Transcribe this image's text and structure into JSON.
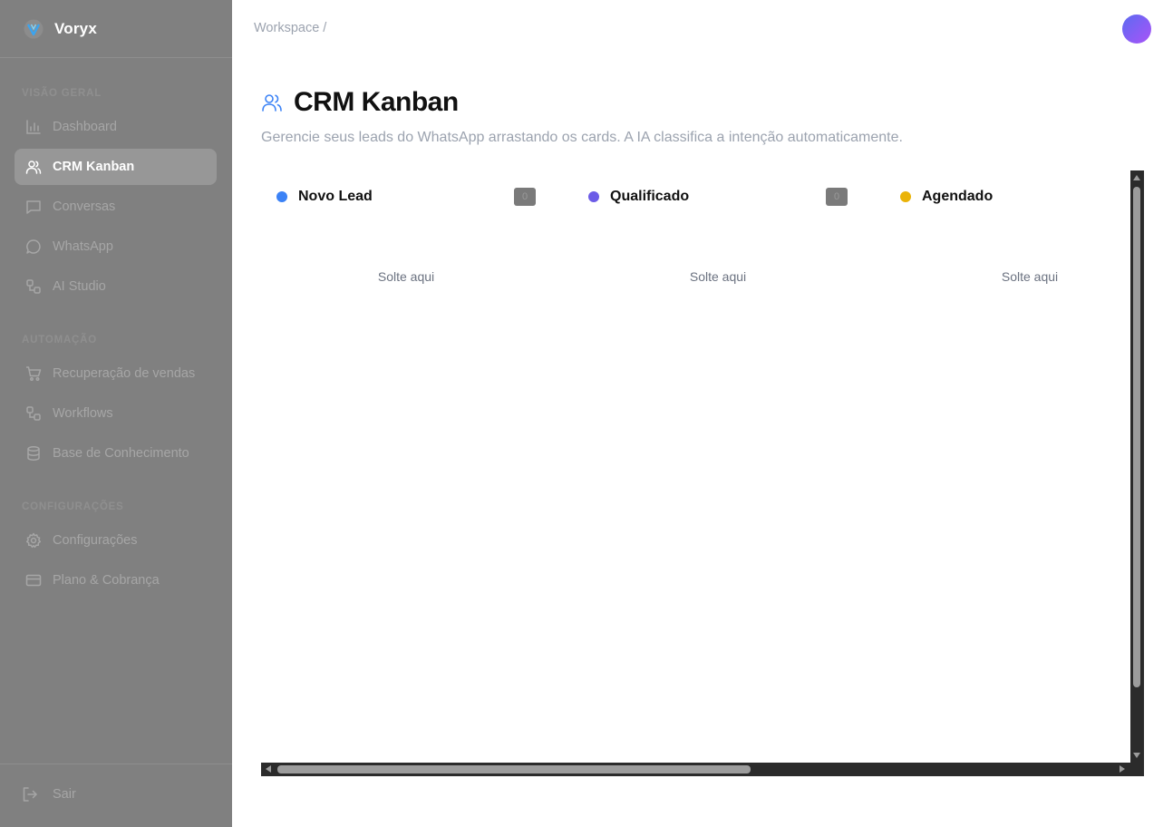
{
  "brand": {
    "name": "Voryx"
  },
  "sidebar": {
    "sections": [
      {
        "label": "VISÃO GERAL"
      },
      {
        "label": "AUTOMAÇÃO"
      },
      {
        "label": "CONFIGURAÇÕES"
      }
    ],
    "items": [
      {
        "label": "Dashboard",
        "icon": "bar-chart-icon",
        "active": false
      },
      {
        "label": "CRM Kanban",
        "icon": "users-icon",
        "active": true
      },
      {
        "label": "Conversas",
        "icon": "message-square-icon",
        "active": false
      },
      {
        "label": "WhatsApp",
        "icon": "message-circle-icon",
        "active": false
      },
      {
        "label": "AI Studio",
        "icon": "nodes-icon",
        "active": false
      },
      {
        "label": "Recuperação de vendas",
        "icon": "cart-icon",
        "active": false
      },
      {
        "label": "Workflows",
        "icon": "workflow-icon",
        "active": false
      },
      {
        "label": "Base de Conhecimento",
        "icon": "database-icon",
        "active": false
      },
      {
        "label": "Configurações",
        "icon": "gear-icon",
        "active": false
      },
      {
        "label": "Plano & Cobrança",
        "icon": "credit-card-icon",
        "active": false
      }
    ],
    "logout": {
      "label": "Sair",
      "icon": "logout-icon"
    }
  },
  "header": {
    "breadcrumb": "Workspace /"
  },
  "page": {
    "title": "CRM Kanban",
    "subtitle": "Gerencie seus leads do WhatsApp arrastando os cards. A IA classifica a intenção automaticamente."
  },
  "board": {
    "columns": [
      {
        "title": "Novo Lead",
        "count": "0",
        "color": "#3b82f6",
        "drop_text": "Solte aqui"
      },
      {
        "title": "Qualificado",
        "count": "0",
        "color": "#6c5ce7",
        "drop_text": "Solte aqui"
      },
      {
        "title": "Agendado",
        "count": "",
        "color": "#eab308",
        "drop_text": "Solte aqui"
      }
    ]
  },
  "colors": {
    "sidebar_bg": "#808080",
    "accent": "#3b82f6"
  }
}
